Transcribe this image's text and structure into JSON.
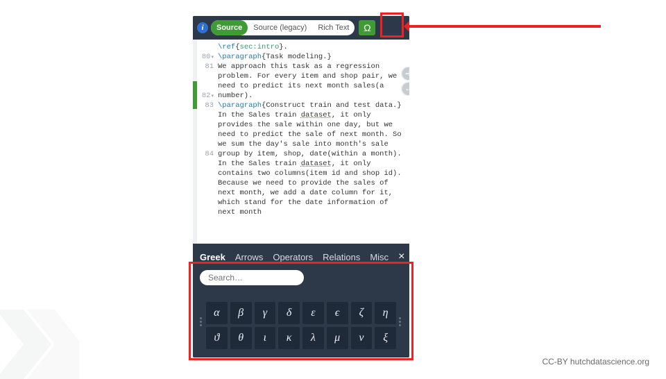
{
  "toolbar": {
    "tabs": [
      "Source",
      "Source (legacy)",
      "Rich Text"
    ],
    "active_tab": "Source",
    "omega_glyph": "Ω"
  },
  "editor": {
    "lines": [
      {
        "n": "",
        "html": "<span class='cmd'>\\ref</span>{<span class='ref'>sec:intro</span>}."
      },
      {
        "n": "80",
        "fold": true,
        "html": "<span class='cmd'>\\paragraph</span>{Task modeling.}"
      },
      {
        "n": "81",
        "html": "We approach this task as a regression problem. For every item and shop pair, we need to predict its next month sales(a number)."
      },
      {
        "n": "82",
        "fold": true,
        "html": "<span class='cmd'>\\paragraph</span>{Construct train and test data.}"
      },
      {
        "n": "83",
        "html": "In the Sales train <span class='sq'>dataset</span>, it only provides the sale within one day, but we need to predict the sale of next month. So we sum the day's sale into month's sale group by item, shop, date(within a month)."
      },
      {
        "n": "84",
        "html": "In the Sales train <span class='sq'>dataset</span>, it only contains two columns(item id and shop id). Because we need to provide the sales of next month, we add a date column for it, which stand for the date information of next month"
      }
    ]
  },
  "symbol_panel": {
    "tabs": [
      "Greek",
      "Arrows",
      "Operators",
      "Relations",
      "Misc"
    ],
    "active_tab": "Greek",
    "search_placeholder": "Search…",
    "symbols_row1": [
      "α",
      "β",
      "γ",
      "δ",
      "ε",
      "ϵ",
      "ζ",
      "η"
    ],
    "symbols_row2": [
      "ϑ",
      "θ",
      "ι",
      "κ",
      "λ",
      "μ",
      "ν",
      "ξ"
    ]
  },
  "credit": "CC-BY hutchdatascience.org"
}
